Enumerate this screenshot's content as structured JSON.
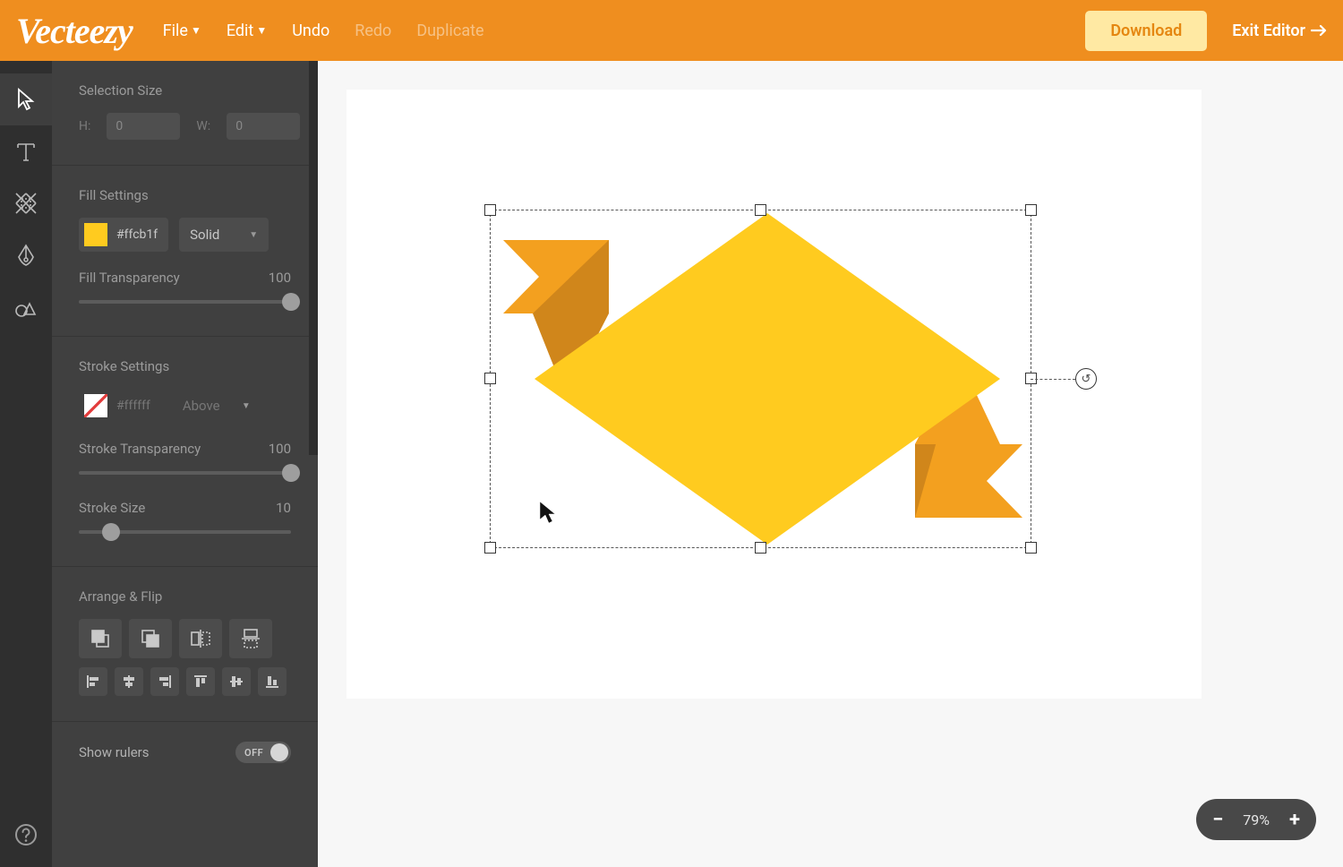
{
  "header": {
    "logo": "Vecteezy",
    "menus": {
      "file": "File",
      "edit": "Edit",
      "undo": "Undo",
      "redo": "Redo",
      "duplicate": "Duplicate"
    },
    "download": "Download",
    "exit": "Exit Editor"
  },
  "tools": {
    "select": "select-tool",
    "text": "text-tool",
    "bgremove": "background-remove-tool",
    "pen": "pen-tool",
    "shapes": "shapes-tool",
    "help": "help"
  },
  "panel": {
    "selection_size": {
      "title": "Selection Size",
      "h_label": "H:",
      "h_value": "0",
      "w_label": "W:",
      "w_value": "0"
    },
    "fill": {
      "title": "Fill Settings",
      "hex": "#ffcb1f",
      "mode": "Solid",
      "transparency_label": "Fill Transparency",
      "transparency_value": "100"
    },
    "stroke": {
      "title": "Stroke Settings",
      "hex": "#ffffff",
      "position": "Above",
      "transparency_label": "Stroke Transparency",
      "transparency_value": "100",
      "size_label": "Stroke Size",
      "size_value": "10"
    },
    "arrange": {
      "title": "Arrange & Flip"
    },
    "rulers": {
      "label": "Show rulers",
      "state": "OFF"
    }
  },
  "canvas": {
    "zoom_value": "79%",
    "zoom_minus": "−",
    "zoom_plus": "+"
  },
  "colors": {
    "accent": "#ef8e1f",
    "fill_swatch": "#ffcb1f"
  }
}
